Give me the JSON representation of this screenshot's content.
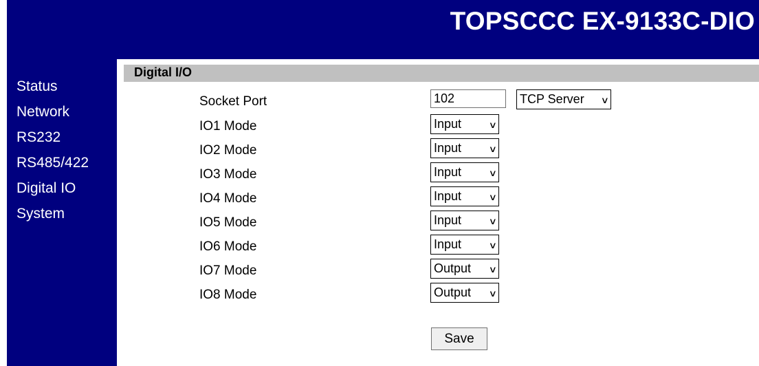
{
  "header": {
    "title": "TOPSCCC EX-9133C-DIO"
  },
  "sidebar": {
    "items": [
      {
        "label": "Status"
      },
      {
        "label": "Network"
      },
      {
        "label": "RS232"
      },
      {
        "label": "RS485/422"
      },
      {
        "label": "Digital IO"
      },
      {
        "label": "System"
      }
    ]
  },
  "section": {
    "title": "Digital I/O"
  },
  "socket": {
    "label": "Socket Port",
    "port_value": "102",
    "protocol": "TCP Server"
  },
  "io_modes": [
    {
      "label": "IO1 Mode",
      "value": "Input"
    },
    {
      "label": "IO2 Mode",
      "value": "Input"
    },
    {
      "label": "IO3 Mode",
      "value": "Input"
    },
    {
      "label": "IO4 Mode",
      "value": "Input"
    },
    {
      "label": "IO5 Mode",
      "value": "Input"
    },
    {
      "label": "IO6 Mode",
      "value": "Input"
    },
    {
      "label": "IO7 Mode",
      "value": "Output"
    },
    {
      "label": "IO8 Mode",
      "value": "Output"
    }
  ],
  "save_label": "Save",
  "colors": {
    "nav_background": "#00007f",
    "section_bar": "#c0c0c0",
    "text_on_nav": "#ffffff"
  }
}
